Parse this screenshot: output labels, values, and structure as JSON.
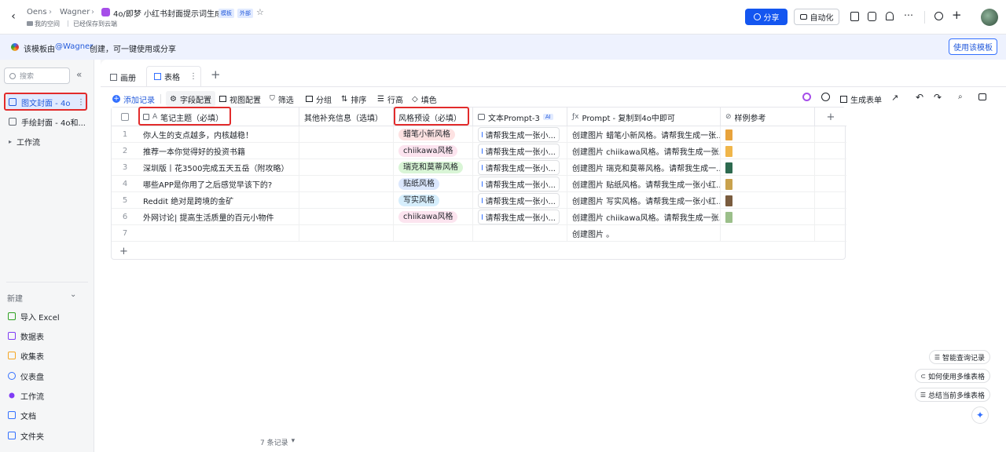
{
  "topbar": {
    "breadcrumb_space": "Oens",
    "breadcrumb_user": "Wagner",
    "doc_title": "4o/即梦 小红书封面提示词生成",
    "badge_template": "模板",
    "badge_external": "外部",
    "sub_location": "我的空间",
    "sub_status": "已经保存到云端",
    "share_label": "分享",
    "automation_label": "自动化"
  },
  "banner": {
    "text_prefix": "该模板由",
    "author": "@Wagner",
    "text_suffix": "创建，可一键使用或分享",
    "use_template": "使用该模板"
  },
  "sidebar": {
    "search_placeholder": "搜索",
    "items": [
      {
        "label": "图文封面 - 4o"
      },
      {
        "label": "手绘封面 - 4o和..."
      },
      {
        "label": "工作流"
      }
    ],
    "new_label": "新建",
    "create_items": [
      {
        "label": "导入 Excel",
        "color": "#2ea121"
      },
      {
        "label": "数据表",
        "color": "#7f3bf5"
      },
      {
        "label": "收集表",
        "color": "#f5a623"
      },
      {
        "label": "仪表盘",
        "color": "#3370ff"
      },
      {
        "label": "工作流",
        "color": "#7f3bf5"
      },
      {
        "label": "文档",
        "color": "#3370ff"
      },
      {
        "label": "文件夹",
        "color": "#3370ff"
      }
    ]
  },
  "tabs": {
    "gallery": "画册",
    "table": "表格"
  },
  "toolbar": {
    "add_record": "添加记录",
    "field_config": "字段配置",
    "view_config": "视图配置",
    "filter": "筛选",
    "group": "分组",
    "sort": "排序",
    "row_height": "行高",
    "fill_color": "填色",
    "generate_form": "生成表单"
  },
  "table": {
    "headers": {
      "topic": "笔记主题（必填）",
      "extra": "其他补充信息（选填）",
      "style": "风格预设（必填）",
      "prompt3": "文本Prompt-3",
      "ai_badge": "AI",
      "prompt": "Prompt - 复制到4o中即可",
      "sample": "样例参考"
    },
    "rows": [
      {
        "num": "1",
        "topic": "你人生的支点越多，内核越稳！",
        "style": "蜡笔小新风格",
        "style_bg": "#fde2e2",
        "prompt3": "请帮我生成一张小...",
        "prompt": "创建图片 蜡笔小新风格。请帮我生成一张...",
        "thumb": "#e8a33c"
      },
      {
        "num": "2",
        "topic": "推荐一本你觉得好的投资书籍",
        "style": "chiikawa风格",
        "style_bg": "#fce4ef",
        "prompt3": "请帮我生成一张小...",
        "prompt": "创建图片 chiikawa风格。请帮我生成一张...",
        "thumb": "#f0b64a"
      },
      {
        "num": "3",
        "topic": "深圳版丨花3500完成五天五岳（附攻略）",
        "style": "瑞克和莫蒂风格",
        "style_bg": "#d9f5d6",
        "prompt3": "请帮我生成一张小...",
        "prompt": "创建图片 瑞克和莫蒂风格。请帮我生成一...",
        "thumb": "#2d6a4f"
      },
      {
        "num": "4",
        "topic": "哪些APP是你用了之后感觉早该下的?",
        "style": "贴纸风格",
        "style_bg": "#dbe7fd",
        "prompt3": "请帮我生成一张小...",
        "prompt": "创建图片 贴纸风格。请帮我生成一张小红...",
        "thumb": "#c9a24d"
      },
      {
        "num": "5",
        "topic": "Reddit 绝对是跨境的金矿",
        "style": "写实风格",
        "style_bg": "#d6eefc",
        "prompt3": "请帮我生成一张小...",
        "prompt": "创建图片 写实风格。请帮我生成一张小红...",
        "thumb": "#7a5c3e"
      },
      {
        "num": "6",
        "topic": "外网讨论| 提高生活质量的百元小物件",
        "style": "chiikawa风格",
        "style_bg": "#fce4ef",
        "prompt3": "请帮我生成一张小...",
        "prompt": "创建图片 chiikawa风格。请帮我生成一张...",
        "thumb": "#9bbf8a"
      },
      {
        "num": "7",
        "topic": "",
        "style": "",
        "style_bg": "",
        "prompt3": "",
        "prompt": "创建图片 。",
        "thumb": ""
      }
    ]
  },
  "footer": {
    "record_count": "7 条记录"
  },
  "floating": {
    "smart_query": "智能查询记录",
    "how_to_use": "如何使用多维表格",
    "summarize": "总结当前多维表格"
  }
}
